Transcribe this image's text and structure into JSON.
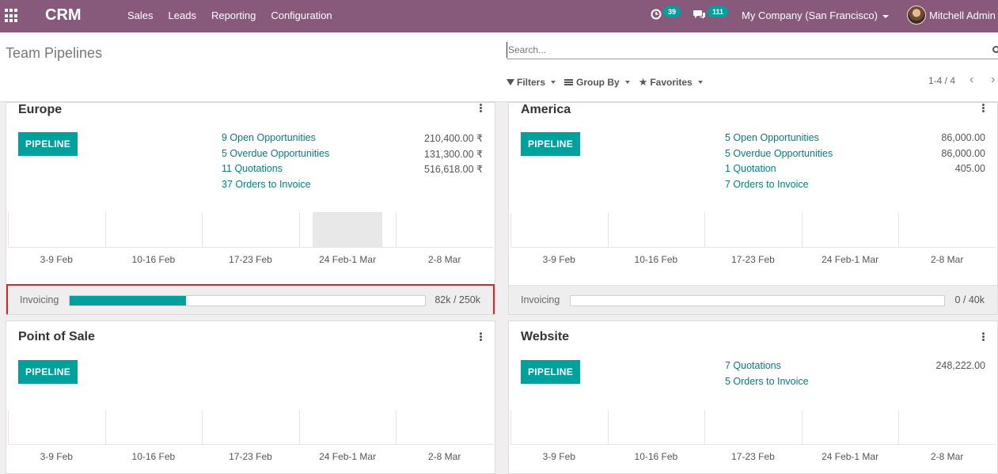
{
  "navbar": {
    "brand": "CRM",
    "menu": [
      "Sales",
      "Leads",
      "Reporting",
      "Configuration"
    ],
    "activity_count": "39",
    "message_count": "111",
    "company": "My Company (San Francisco)",
    "user": "Mitchell Admin"
  },
  "control_panel": {
    "title": "Team Pipelines",
    "search_placeholder": "Search...",
    "filters_label": "Filters",
    "group_by_label": "Group By",
    "favorites_label": "Favorites",
    "pager": "1-4 / 4"
  },
  "graph_labels": [
    "3-9 Feb",
    "10-16 Feb",
    "17-23 Feb",
    "24 Feb-1 Mar",
    "2-8 Mar"
  ],
  "teams": [
    {
      "name": "Europe",
      "pipeline_label": "PIPELINE",
      "stats": [
        {
          "label": "9 Open Opportunities",
          "value": "210,400.00 ₹"
        },
        {
          "label": "5 Overdue Opportunities",
          "value": "131,300.00 ₹"
        },
        {
          "label": "11 Quotations",
          "value": "516,618.00 ₹"
        },
        {
          "label": "37 Orders to Invoice",
          "value": ""
        }
      ],
      "invoicing_label": "Invoicing",
      "invoicing_value": "82k / 250k",
      "invoicing_fraction": 0.328
    },
    {
      "name": "America",
      "pipeline_label": "PIPELINE",
      "stats": [
        {
          "label": "5 Open Opportunities",
          "value": "86,000.00"
        },
        {
          "label": "5 Overdue Opportunities",
          "value": "86,000.00"
        },
        {
          "label": "1 Quotation",
          "value": "405.00"
        },
        {
          "label": "7 Orders to Invoice",
          "value": ""
        }
      ],
      "invoicing_label": "Invoicing",
      "invoicing_value": "0 / 40k",
      "invoicing_fraction": 0
    },
    {
      "name": "Point of Sale",
      "pipeline_label": "PIPELINE",
      "stats": []
    },
    {
      "name": "Website",
      "pipeline_label": "PIPELINE",
      "stats": [
        {
          "label": "7 Quotations",
          "value": "248,222.00"
        },
        {
          "label": "5 Orders to Invoice",
          "value": ""
        }
      ]
    }
  ],
  "colors": {
    "navbar": "#875a7b",
    "accent": "#00a09d",
    "link": "#00807e",
    "highlight_border": "#e02424"
  }
}
